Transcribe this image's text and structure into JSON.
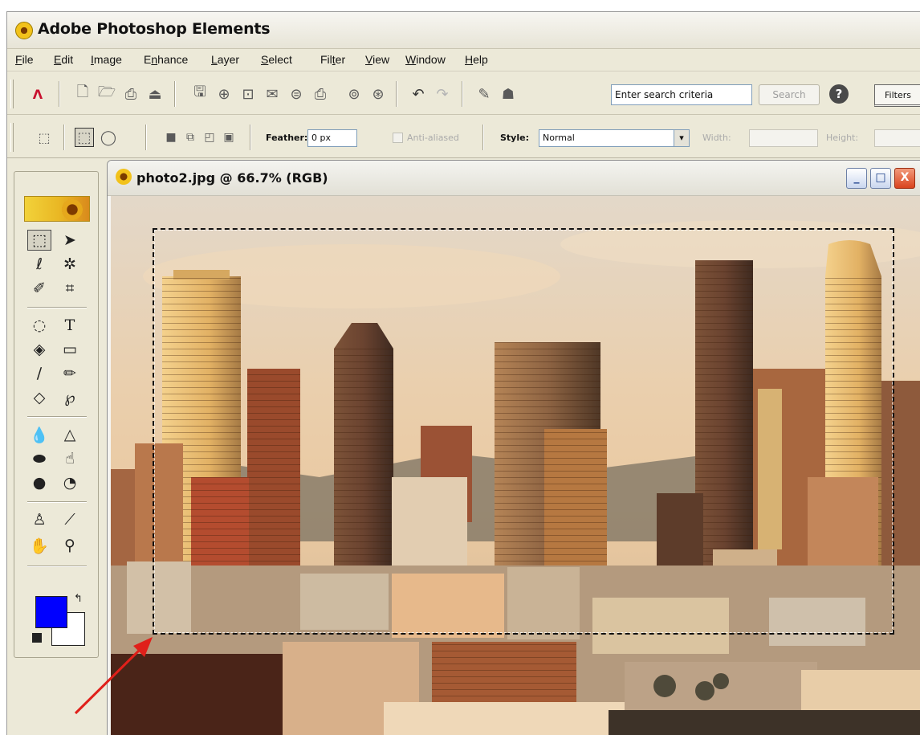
{
  "app": {
    "title": "Adobe Photoshop Elements",
    "logo_icon": "sunflower-logo-icon"
  },
  "menu": [
    {
      "label": "File",
      "u": "F"
    },
    {
      "label": "Edit",
      "u": "E"
    },
    {
      "label": "Image",
      "u": "I"
    },
    {
      "label": "Enhance",
      "u": "n"
    },
    {
      "label": "Layer",
      "u": "L"
    },
    {
      "label": "Select",
      "u": "S"
    },
    {
      "label": "Filter",
      "u": "t"
    },
    {
      "label": "View",
      "u": "V"
    },
    {
      "label": "Window",
      "u": "W"
    },
    {
      "label": "Help",
      "u": "H"
    }
  ],
  "toolbar": {
    "search_placeholder_value": "Enter search criteria",
    "search_button": "Search",
    "help_glyph": "?",
    "filters_tab": "Filters"
  },
  "options_bar": {
    "feather_label": "Feather:",
    "feather_value": "0 px",
    "anti_aliased_label": "Anti-aliased",
    "style_label": "Style:",
    "style_value": "Normal",
    "width_label": "Width:",
    "height_label": "Height:"
  },
  "document": {
    "title": "photo2.jpg @ 66.7% (RGB)",
    "minimize_glyph": "_",
    "maximize_glyph": "□",
    "close_glyph": "X"
  },
  "colors": {
    "foreground": "#0000ff",
    "background": "#ffffff",
    "annotation_arrow": "#e0201a"
  }
}
